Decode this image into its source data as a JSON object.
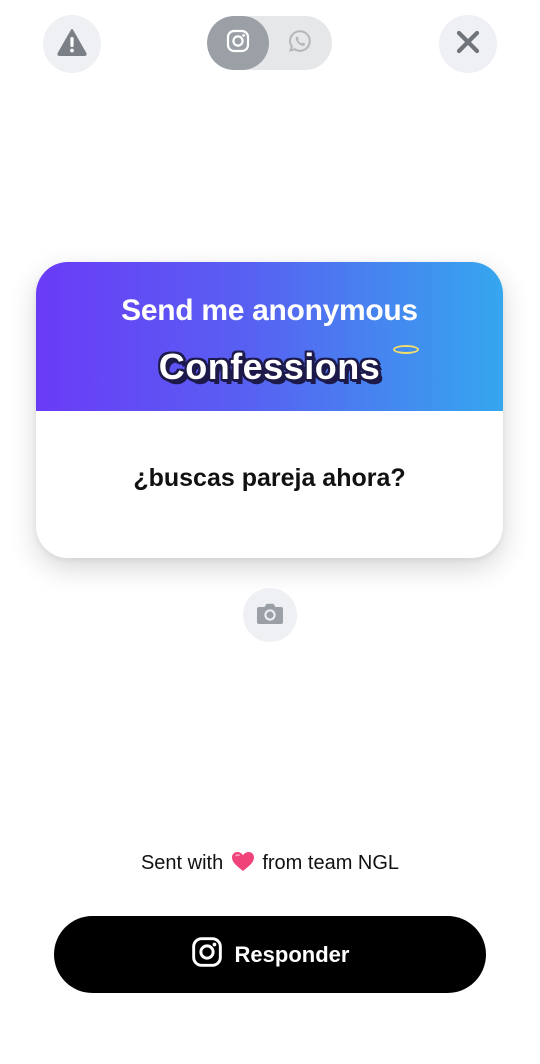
{
  "top_bar": {
    "report_icon": "warning-icon",
    "share_toggle": {
      "options": [
        {
          "icon": "instagram-icon",
          "active": true
        },
        {
          "icon": "whatsapp-icon",
          "active": false
        }
      ]
    },
    "close_icon": "close-icon"
  },
  "card": {
    "title": "Send me anonymous",
    "subtitle": "Confessions",
    "question": "¿buscas pareja ahora?",
    "colors": {
      "gradient_start": "#6a3bf7",
      "gradient_end": "#35a7ee",
      "halo": "#f3dd6a"
    }
  },
  "camera_icon": "camera-icon",
  "footer": {
    "prefix": "Sent with",
    "heart_icon": "heart-icon",
    "suffix": "from team NGL"
  },
  "reply_button": {
    "label": "Responder",
    "icon": "instagram-icon"
  }
}
